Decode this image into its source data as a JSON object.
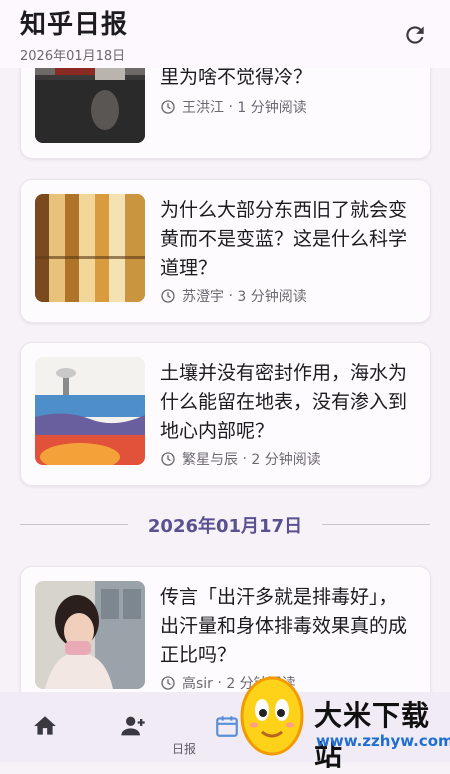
{
  "header": {
    "title": "知乎日报",
    "date": "2026年01月18日"
  },
  "articles": [
    {
      "title": "里为啥不觉得冷？",
      "author": "王洪江",
      "read_time": "1 分钟阅读"
    },
    {
      "title": "为什么大部分东西旧了就会变黄而不是变蓝？这是什么科学道理？",
      "author": "苏澄宇",
      "read_time": "3 分钟阅读"
    },
    {
      "title": "土壤并没有密封作用，海水为什么能留在地表，没有渗入到地心内部呢？",
      "author": "繁星与辰",
      "read_time": "2 分钟阅读"
    },
    {
      "title": "传言「出汗多就是排毒好」，出汗量和身体排毒效果真的成正比吗？",
      "author": "高sir",
      "read_time": "2 分钟阅读"
    }
  ],
  "meta_separator": " · ",
  "section_date": "2026年01月17日",
  "nav": {
    "items": [
      {
        "label": "首页",
        "icon": "home-icon"
      },
      {
        "label": "关注",
        "icon": "person-add-icon"
      },
      {
        "label": "日报",
        "icon": "calendar-icon"
      }
    ]
  },
  "watermark": {
    "text": "大米下载站",
    "url": "www.zzhyw.com"
  },
  "colors": {
    "accent": "#5a5191",
    "background": "#f7f2f8",
    "card": "#fefbff",
    "muted_text": "#6b6870"
  }
}
